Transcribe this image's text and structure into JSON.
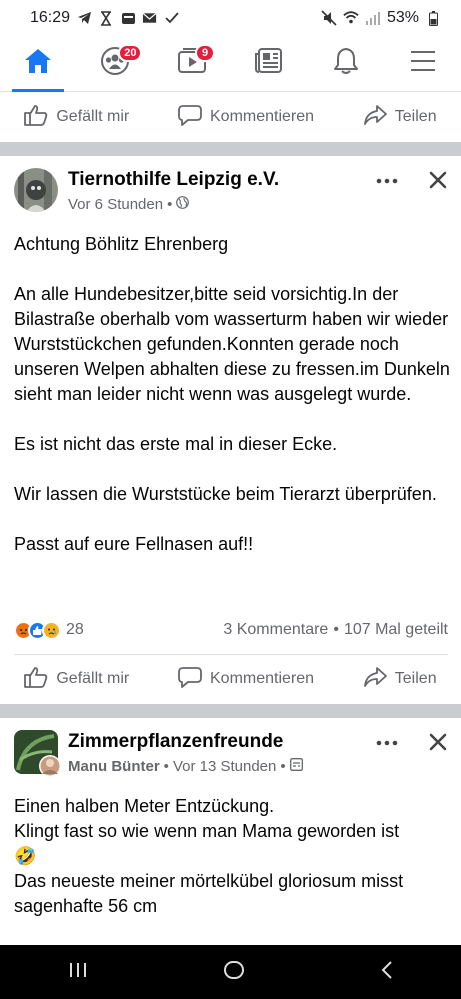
{
  "status_bar": {
    "time": "16:29",
    "battery": "53%"
  },
  "nav": {
    "tabs": [
      {
        "name": "home",
        "active": true
      },
      {
        "name": "groups",
        "badge": "20"
      },
      {
        "name": "watch",
        "badge": "9"
      },
      {
        "name": "news"
      },
      {
        "name": "notifications"
      },
      {
        "name": "menu"
      }
    ]
  },
  "actions": {
    "like": "Gefällt mir",
    "comment": "Kommentieren",
    "share": "Teilen"
  },
  "post1": {
    "page_name": "Tiernothilfe Leipzig e.V.",
    "time": "Vor 6 Stunden",
    "separator": "•",
    "paragraphs": [
      "Achtung Böhlitz Ehrenberg",
      "An alle Hundebesitzer,bitte seid  vorsichtig.In der Bilastraße oberhalb vom wasserturm haben wir wieder Wurststückchen gefunden.Konnten gerade noch unseren Welpen abhalten diese zu fressen.im Dunkeln sieht man leider nicht wenn was ausgelegt wurde.",
      "Es ist nicht das erste mal in dieser Ecke.",
      "Wir lassen die Wurststücke   beim Tierarzt überprüfen.",
      "Passt auf eure Fellnasen auf!!"
    ],
    "reaction_count": "28",
    "comments": "3 Kommentare",
    "shares": "107 Mal geteilt"
  },
  "post2": {
    "group_name": "Zimmerpflanzenfreunde",
    "author": "Manu Bünter",
    "time": "Vor 13 Stunden",
    "line1": "Einen halben Meter Entzückung.",
    "line2": "Klingt fast so wie wenn man Mama geworden ist",
    "emoji": "🤣",
    "line3": "Das neueste meiner mörtelkübel gloriosum misst sagenhafte 56 cm"
  },
  "colors": {
    "accent": "#1877f2",
    "badge": "#e41e3f",
    "secondary_text": "#65676b",
    "divider": "#c9ccd1"
  }
}
